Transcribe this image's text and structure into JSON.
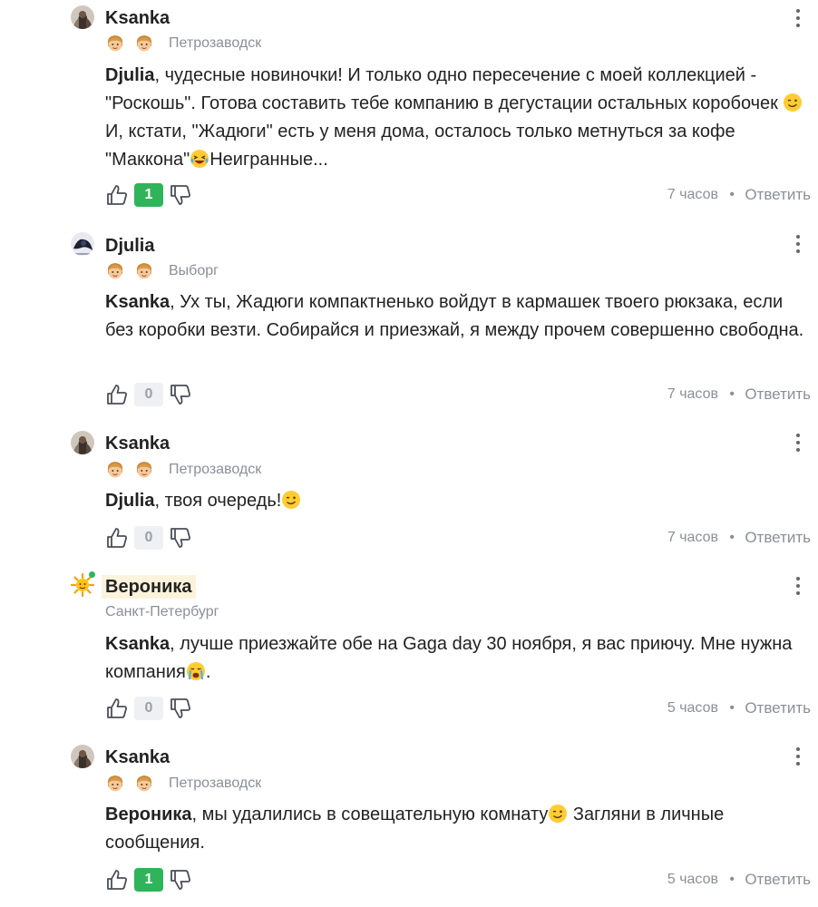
{
  "comments": [
    {
      "author": "Ksanka",
      "city": "Петрозаводск",
      "mention": "Djulia",
      "t1": ", чудесные новиночки! И только одно пересечение с моей коллекцией - \"Роскошь\". Готова составить тебе компанию в дегустации остальных коробочек",
      "t2": " И, кстати, \"Жадюги\" есть у меня дома, осталось только метнуться за кофе \"Маккона\"",
      "t3": "Неигранные...",
      "score": "1",
      "time": "7 часов",
      "reply": "Ответить"
    },
    {
      "author": "Djulia",
      "city": "Выборг",
      "mention": "Ksanka",
      "t1": ", Ух ты, Жадюги компактненько войдут в кармашек твоего рюкзака, если без коробки везти. Собирайся и приезжай, я между прочем совершенно свободна.",
      "score": "0",
      "time": "7 часов",
      "reply": "Ответить"
    },
    {
      "author": "Ksanka",
      "city": "Петрозаводск",
      "mention": "Djulia",
      "t1": ", твоя очередь!",
      "score": "0",
      "time": "7 часов",
      "reply": "Ответить"
    },
    {
      "author": "Вероника",
      "city": "Санкт-Петербург",
      "mention": "Ksanka",
      "t1": ", лучше приезжайте обе на Gaga day 30 ноября, я вас приючу. Мне нужна компания",
      "t2": ".",
      "score": "0",
      "time": "5 часов",
      "reply": "Ответить"
    },
    {
      "author": "Ksanka",
      "city": "Петрозаводск",
      "mention": "Вероника",
      "t1": ", мы удалились в совещательную комнату",
      "t2": " Загляни в личные сообщения.",
      "score": "1",
      "time": "5 часов",
      "reply": "Ответить"
    }
  ],
  "icons": {
    "avatar": "avatar-photo",
    "badge": "girl-face-badge-icon",
    "more": "more-vertical-icon",
    "like": "thumbs-up-icon",
    "dislike": "thumbs-down-icon",
    "wink": "wink-emoji",
    "laugh": "rofl-emoji",
    "cry": "crying-emoji",
    "sun": "sun-avatar-icon"
  },
  "colors": {
    "positive_score": "#2fb45a",
    "neutral_score_bg": "#eef0f4",
    "meta_text": "#8a8f98",
    "online": "#2fb45a"
  }
}
